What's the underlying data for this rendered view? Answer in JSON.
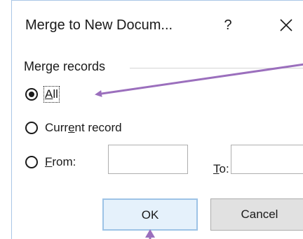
{
  "dialog": {
    "title": "Merge to New Docum...",
    "help_glyph": "?",
    "close_icon": "close-icon"
  },
  "merge_records": {
    "group_label": "Merge records",
    "options": [
      {
        "pre": "",
        "mnemonic": "A",
        "post": "ll",
        "selected": true
      },
      {
        "pre": "Curr",
        "mnemonic": "e",
        "post": "nt record",
        "selected": false
      },
      {
        "pre": "",
        "mnemonic": "F",
        "post": "rom:",
        "selected": false
      }
    ],
    "from_value": "",
    "to_label_mnemonic": "T",
    "to_label_rest": "o:",
    "to_value": ""
  },
  "buttons": {
    "ok_label": "OK",
    "cancel_label": "Cancel"
  },
  "annotation_color": "#9b6fbd"
}
